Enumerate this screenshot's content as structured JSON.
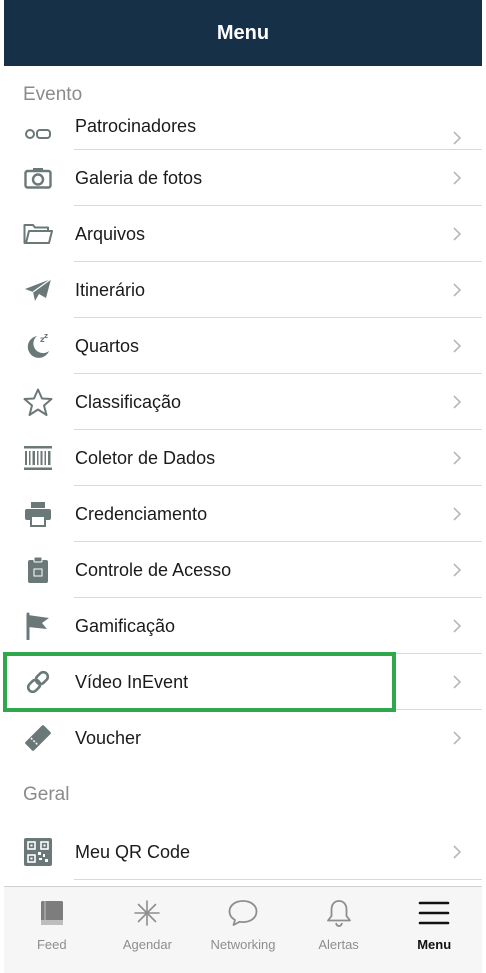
{
  "header": {
    "title": "Menu"
  },
  "sections": [
    {
      "title": "Evento"
    },
    {
      "title": "Geral"
    }
  ],
  "evento_items": [
    {
      "label": "Patrocinadores",
      "icon": "sponsor-icon"
    },
    {
      "label": "Galeria de fotos",
      "icon": "camera-icon"
    },
    {
      "label": "Arquivos",
      "icon": "folder-icon"
    },
    {
      "label": "Itinerário",
      "icon": "paper-plane-icon"
    },
    {
      "label": "Quartos",
      "icon": "moon-sleep-icon"
    },
    {
      "label": "Classificação",
      "icon": "star-icon"
    },
    {
      "label": "Coletor de Dados",
      "icon": "barcode-icon"
    },
    {
      "label": "Credenciamento",
      "icon": "printer-icon"
    },
    {
      "label": "Controle de Acesso",
      "icon": "clipboard-icon"
    },
    {
      "label": "Gamificação",
      "icon": "flag-icon"
    },
    {
      "label": "Vídeo InEvent",
      "icon": "link-icon"
    },
    {
      "label": "Voucher",
      "icon": "ticket-icon"
    }
  ],
  "geral_items": [
    {
      "label": "Meu QR Code",
      "icon": "qr-code-icon"
    }
  ],
  "tabs": [
    {
      "label": "Feed",
      "icon": "book-icon"
    },
    {
      "label": "Agendar",
      "icon": "asterisk-icon"
    },
    {
      "label": "Networking",
      "icon": "chat-bubble-icon"
    },
    {
      "label": "Alertas",
      "icon": "bell-icon"
    },
    {
      "label": "Menu",
      "icon": "hamburger-icon",
      "active": true
    }
  ],
  "colors": {
    "header_bg": "#163048",
    "highlight": "#2ea84a",
    "icon_gray": "#6b7878"
  }
}
